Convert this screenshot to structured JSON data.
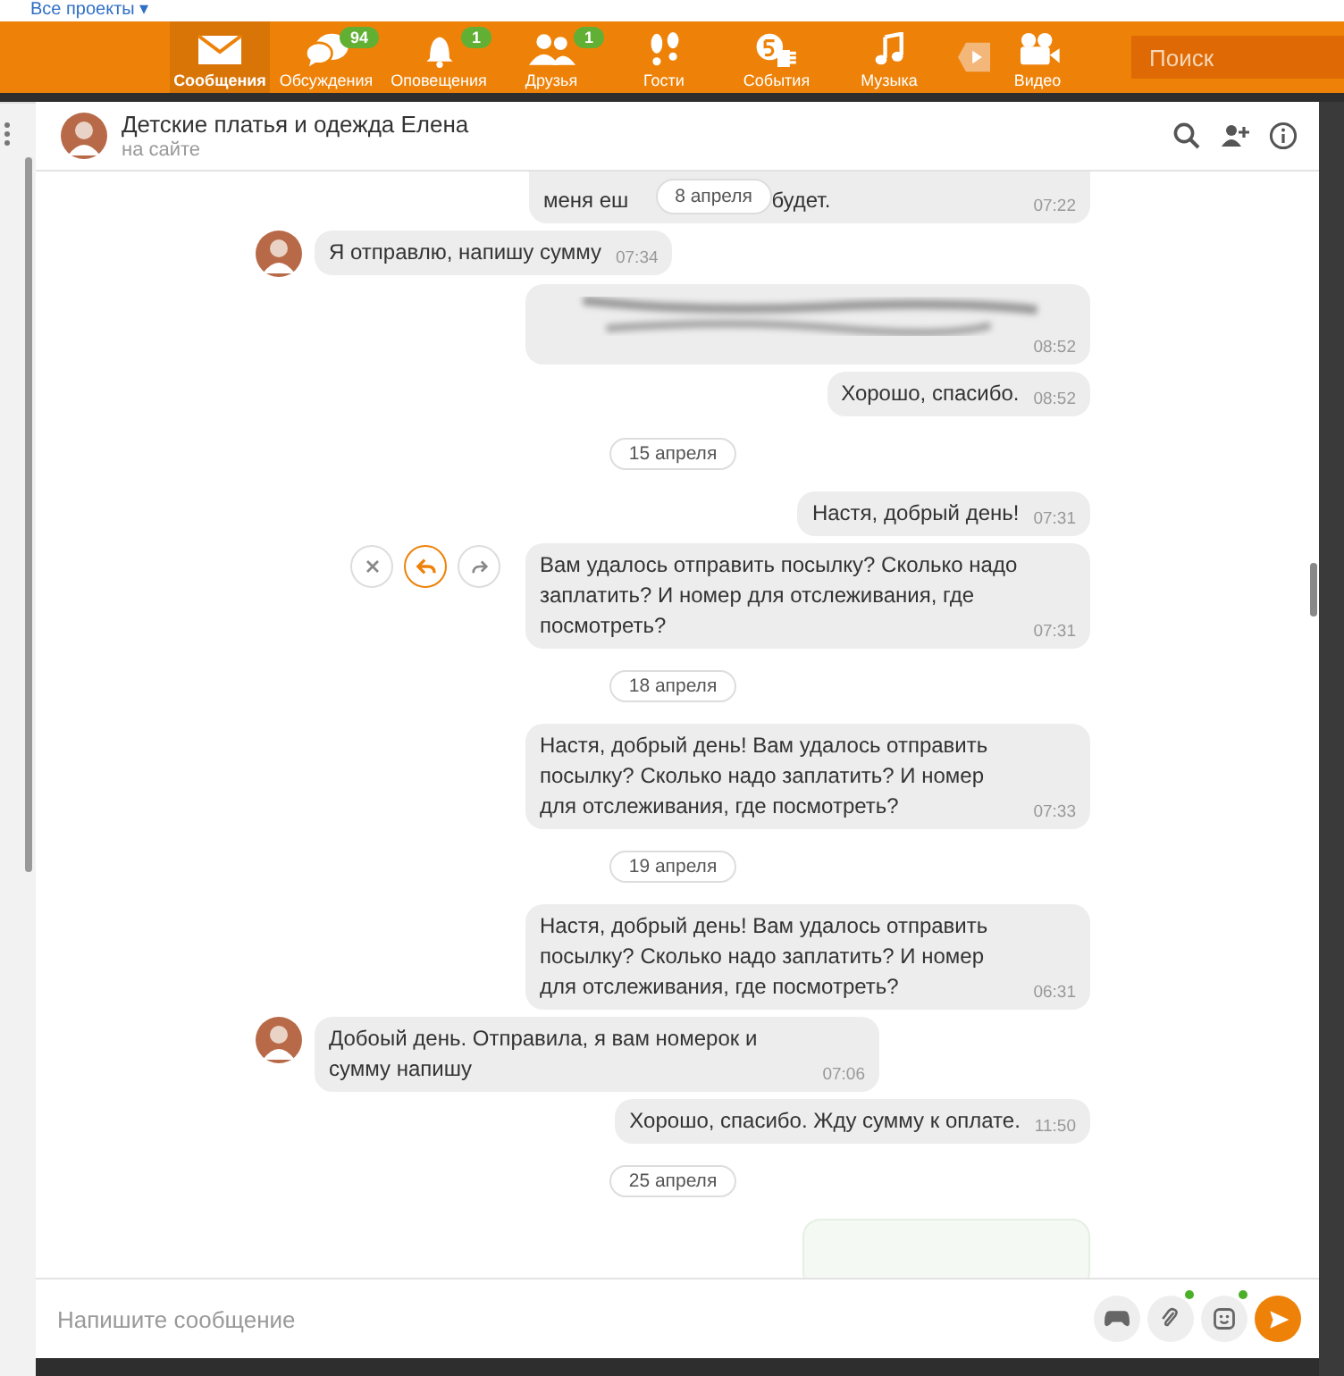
{
  "top_link": {
    "label": "Все проекты ▾"
  },
  "nav": [
    {
      "kind": "mail",
      "label": "Сообщения",
      "selected": true
    },
    {
      "kind": "chat",
      "label": "Обсуждения",
      "selected": false,
      "badge": "94"
    },
    {
      "kind": "bell",
      "label": "Оповещения",
      "selected": false,
      "badge": "1"
    },
    {
      "kind": "friends",
      "label": "Друзья",
      "selected": false,
      "badge": "1"
    },
    {
      "kind": "feet",
      "label": "Гости",
      "selected": false
    },
    {
      "kind": "events",
      "label": "События",
      "selected": false
    },
    {
      "kind": "music",
      "label": "Музыка",
      "selected": false
    },
    {
      "kind": "video",
      "label": "Видео",
      "selected": false
    }
  ],
  "search": {
    "placeholder": "Поиск"
  },
  "chat": {
    "name": "Детские платья и одежда Елена",
    "status": "на сайте"
  },
  "messages": [
    {
      "kind": "partial",
      "before": "меня еш",
      "after": "будет.",
      "time": "07:22",
      "date": "8 апреля"
    },
    {
      "kind": "in",
      "text": "Я отправлю, напишу сумму",
      "time": "07:34"
    },
    {
      "kind": "blurred",
      "time": "08:52"
    },
    {
      "kind": "out",
      "text": "Хорошо, спасибо.",
      "time": "08:52",
      "hovered": false
    },
    {
      "kind": "date",
      "text": "15 апреля"
    },
    {
      "kind": "out",
      "text": "Настя, добрый день!",
      "time": "07:31",
      "hovered": false
    },
    {
      "kind": "out",
      "text": "Вам удалось отправить посылку? Сколько надо заплатить? И номер для отслеживания, где посмотреть?",
      "time": "07:31",
      "hovered": true
    },
    {
      "kind": "date",
      "text": "18 апреля"
    },
    {
      "kind": "out",
      "text": "Настя, добрый день! Вам удалось отправить посылку? Сколько надо заплатить? И номер для отслеживания, где посмотреть?",
      "time": "07:33",
      "hovered": false
    },
    {
      "kind": "date",
      "text": "19 апреля"
    },
    {
      "kind": "out",
      "text": "Настя, добрый день! Вам удалось отправить посылку? Сколько надо заплатить? И номер для отслеживания, где посмотреть?",
      "time": "06:31",
      "hovered": false
    },
    {
      "kind": "in",
      "text": "Добоый день. Отправила, я вам номерок и сумму напишу",
      "time": "07:06"
    },
    {
      "kind": "out",
      "text": "Хорошо, спасибо. Жду сумму к оплате.",
      "time": "11:50",
      "hovered": false
    },
    {
      "kind": "date",
      "text": "25 апреля"
    },
    {
      "kind": "cut"
    }
  ],
  "composer": {
    "placeholder": "Напишите сообщение"
  }
}
